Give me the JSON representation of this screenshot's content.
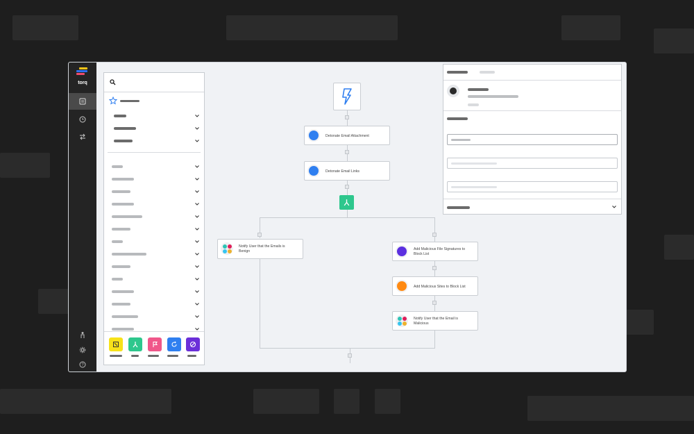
{
  "app": {
    "logo_text": "torq",
    "logo_colors": [
      "#f5c518",
      "#2f6fed",
      "#ef4b6c"
    ],
    "rail": {
      "top_items": [
        "workflows-icon",
        "history-icon",
        "integrations-icon"
      ],
      "bottom_items": [
        "user-icon",
        "settings-icon",
        "help-icon"
      ],
      "active": "workflows-icon"
    }
  },
  "step_library": {
    "search_placeholder": "",
    "favorite_icon": "star-icon",
    "footer_tiles": [
      {
        "name": "integration-tile",
        "color": "#f7e21a",
        "icon": "step-icon"
      },
      {
        "name": "branch-tile",
        "color": "#2ec78d",
        "icon": "fork-icon"
      },
      {
        "name": "flag-tile",
        "color": "#f0578a",
        "icon": "flag-icon"
      },
      {
        "name": "loop-tile",
        "color": "#2f7ff0",
        "icon": "loop-icon"
      },
      {
        "name": "exit-tile",
        "color": "#6b2fd9",
        "icon": "exit-icon"
      }
    ]
  },
  "workflow": {
    "trigger_icon": "bolt-icon",
    "steps": [
      {
        "id": "detonate-attachment",
        "label": "Detonate Email Attachment",
        "icon_color": "#2f7ff0"
      },
      {
        "id": "detonate-links",
        "label": "Detonate Email Links",
        "icon_color": "#2f7ff0"
      },
      {
        "id": "notify-benign",
        "label": "Notify User that the Emails is Benign",
        "icon": "slack-icon"
      },
      {
        "id": "add-signatures",
        "label": "Add Malicious File Signatures to Block List",
        "icon_color": "#5b2fe0"
      },
      {
        "id": "add-sites",
        "label": "Add Malicious Sites to Block List",
        "icon_color": "#ff8a12"
      },
      {
        "id": "notify-malicious",
        "label": "Notify User that the Email is Malicious",
        "icon": "slack-icon"
      }
    ],
    "branch_icon": "fork-icon"
  },
  "colors": {
    "accent_blue": "#2f7ff0",
    "branch_green": "#2ec78d",
    "slack": [
      "#2ec4b6",
      "#e01e5a",
      "#36c5f0",
      "#ecb22e"
    ]
  }
}
